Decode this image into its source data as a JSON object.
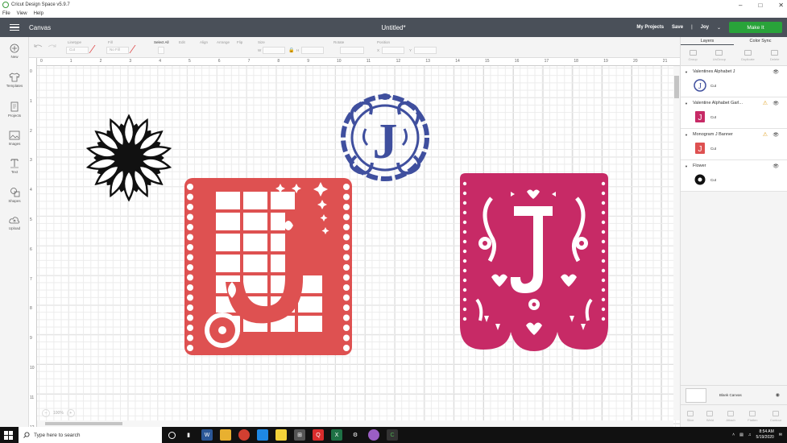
{
  "window": {
    "title": "Cricut Design Space v5.9.7"
  },
  "menu": [
    "File",
    "View",
    "Help"
  ],
  "header": {
    "section": "Canvas",
    "doc_title": "Untitled*",
    "my_projects": "My Projects",
    "save": "Save",
    "separator": "|",
    "user": "Joy",
    "make_it": "Make It"
  },
  "toolbar": {
    "undo": "Undo",
    "redo": "Redo",
    "linetype": "Linetype",
    "linetype_value": "Cut",
    "fill": "Fill",
    "fill_value": "No Fill",
    "select_all": "Select All",
    "edit": "Edit",
    "align": "Align",
    "arrange": "Arrange",
    "flip": "Flip",
    "size": "Size",
    "w": "W",
    "h": "H",
    "rotate": "Rotate",
    "position": "Position",
    "x": "X",
    "y": "Y"
  },
  "sidebar": {
    "items": [
      {
        "label": "New",
        "icon": "plus-circle-icon"
      },
      {
        "label": "Templates",
        "icon": "shirt-icon"
      },
      {
        "label": "Projects",
        "icon": "projects-icon"
      },
      {
        "label": "Images",
        "icon": "image-icon"
      },
      {
        "label": "Text",
        "icon": "text-icon"
      },
      {
        "label": "Shapes",
        "icon": "shapes-icon"
      },
      {
        "label": "Upload",
        "icon": "upload-icon"
      }
    ]
  },
  "ruler": {
    "top": [
      "0",
      "1",
      "2",
      "3",
      "4",
      "5",
      "6",
      "7",
      "8",
      "9",
      "10",
      "11",
      "12",
      "13",
      "14",
      "15",
      "16",
      "17",
      "18",
      "19",
      "20",
      "21"
    ],
    "left": [
      "0",
      "1",
      "2",
      "3",
      "4",
      "5",
      "6",
      "7",
      "8",
      "9",
      "10",
      "11",
      "12"
    ]
  },
  "canvas": {
    "zoom": "100%",
    "banner_letter": "J",
    "monogram_letter": "J",
    "pink_letter": "J",
    "colors": {
      "sunflower": "#111111",
      "red_banner": "#de5151",
      "monogram": "#3f4f9e",
      "pink_banner": "#c72a66"
    }
  },
  "panel": {
    "tabs": [
      "Layers",
      "Color Sync"
    ],
    "actions": [
      "Group",
      "UnGroup",
      "Duplicate",
      "Delete"
    ],
    "layers": [
      {
        "name": "Valentines Alphabet J",
        "op": "Cut",
        "warn": false,
        "color": "#3f4f9e"
      },
      {
        "name": "Valentine Alphabet Garl...",
        "op": "Cut",
        "warn": true,
        "color": "#c72a66"
      },
      {
        "name": "Monogram J Banner",
        "op": "Cut",
        "warn": true,
        "color": "#de5151"
      },
      {
        "name": "Flower",
        "op": "Cut",
        "warn": false,
        "color": "#111111"
      }
    ],
    "blank_canvas": "Blank Canvas",
    "bottom_actions": [
      "Slice",
      "Weld",
      "Attach",
      "Flatten",
      "Contour"
    ]
  },
  "taskbar": {
    "search_placeholder": "Type here to search",
    "time": "8:54 AM",
    "date": "5/19/2020"
  }
}
